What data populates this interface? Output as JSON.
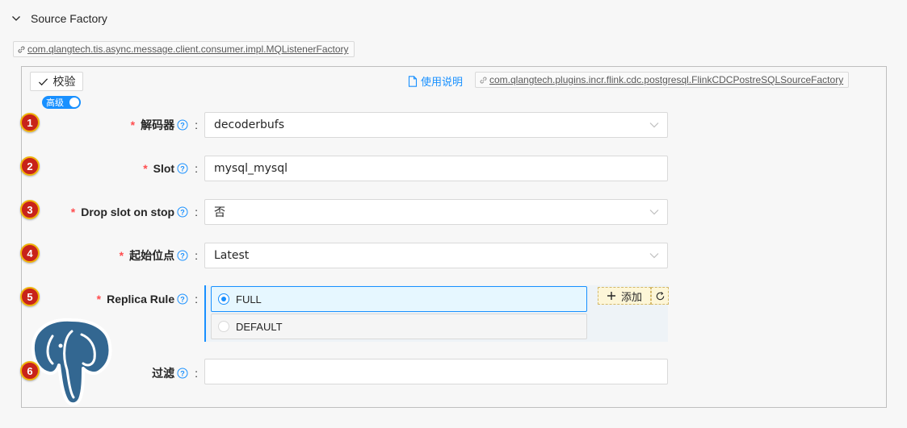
{
  "section": {
    "title": "Source Factory"
  },
  "outer_factory_tag": "com.qlangtech.tis.async.message.client.consumer.impl.MQListenerFactory",
  "panel": {
    "validate_label": "校验",
    "doc_link_label": "使用说明",
    "factory_tag": "com.qlangtech.plugins.incr.flink.cdc.postgresql.FlinkCDCPostreSQLSourceFactory",
    "advanced_toggle_label": "高级",
    "advanced_on": true
  },
  "fields": [
    {
      "badge": "1",
      "label": "解码器",
      "required": true,
      "value": "decoderbufs",
      "kind": "select"
    },
    {
      "badge": "2",
      "label": "Slot",
      "required": true,
      "value": "mysql_mysql",
      "kind": "input"
    },
    {
      "badge": "3",
      "label": "Drop slot on stop",
      "required": true,
      "value": "否",
      "kind": "select"
    },
    {
      "badge": "4",
      "label": "起始位点",
      "required": true,
      "value": "Latest",
      "kind": "select"
    },
    {
      "badge": "5",
      "label": "Replica Rule",
      "required": true,
      "kind": "radio"
    },
    {
      "badge": "6",
      "label": "过滤",
      "required": false,
      "value": "",
      "kind": "input"
    }
  ],
  "replica_rule": {
    "options": [
      "FULL",
      "DEFAULT"
    ],
    "selected": "FULL",
    "add_label": "添加"
  },
  "colors": {
    "primary": "#1890ff",
    "required": "#ff4d4f",
    "badge": "#c8231a"
  }
}
